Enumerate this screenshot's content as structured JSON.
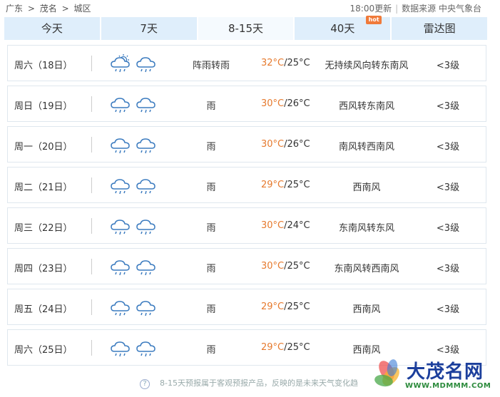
{
  "breadcrumb": {
    "province": "广东",
    "city": "茂名",
    "district": "城区",
    "sep": ">"
  },
  "source": {
    "update_time": "18:00更新",
    "label": "数据来源 中央气象台"
  },
  "tabs": [
    {
      "label": "今天"
    },
    {
      "label": "7天"
    },
    {
      "label": "8-15天",
      "active": true
    },
    {
      "label": "40天",
      "badge": "hot"
    },
    {
      "label": "雷达图"
    }
  ],
  "colors": {
    "tab_bg": "#dfeefb",
    "temp_high": "#e67a2e",
    "icon": "#3b7bbf"
  },
  "forecast": [
    {
      "day": "周六（18日）",
      "icons": [
        "partly-sunny-rain-icon",
        "cloud-rain-icon"
      ],
      "desc": "阵雨转雨",
      "high": "32°C",
      "low": "/25°C",
      "wind": "无持续风向转东南风",
      "level": "<3级"
    },
    {
      "day": "周日（19日）",
      "icons": [
        "cloud-rain-icon",
        "cloud-rain-icon"
      ],
      "desc": "雨",
      "high": "30°C",
      "low": "/26°C",
      "wind": "西风转东南风",
      "level": "<3级"
    },
    {
      "day": "周一（20日）",
      "icons": [
        "cloud-rain-icon",
        "cloud-rain-icon"
      ],
      "desc": "雨",
      "high": "30°C",
      "low": "/26°C",
      "wind": "南风转西南风",
      "level": "<3级"
    },
    {
      "day": "周二（21日）",
      "icons": [
        "cloud-rain-icon",
        "cloud-rain-icon"
      ],
      "desc": "雨",
      "high": "29°C",
      "low": "/25°C",
      "wind": "西南风",
      "level": "<3级"
    },
    {
      "day": "周三（22日）",
      "icons": [
        "cloud-rain-icon",
        "cloud-rain-icon"
      ],
      "desc": "雨",
      "high": "30°C",
      "low": "/24°C",
      "wind": "东南风转东风",
      "level": "<3级"
    },
    {
      "day": "周四（23日）",
      "icons": [
        "cloud-rain-icon",
        "cloud-rain-icon"
      ],
      "desc": "雨",
      "high": "30°C",
      "low": "/25°C",
      "wind": "东南风转西南风",
      "level": "<3级"
    },
    {
      "day": "周五（24日）",
      "icons": [
        "cloud-rain-icon",
        "cloud-rain-icon"
      ],
      "desc": "雨",
      "high": "29°C",
      "low": "/25°C",
      "wind": "西南风",
      "level": "<3级"
    },
    {
      "day": "周六（25日）",
      "icons": [
        "cloud-rain-icon",
        "cloud-rain-icon"
      ],
      "desc": "雨",
      "high": "29°C",
      "low": "/25°C",
      "wind": "西南风",
      "level": "<3级"
    }
  ],
  "footer_note": "8-15天预报属于客观预报产品，反映的是未来天气变化趋",
  "watermark": {
    "title": "大茂名网",
    "url": "WWW.MDMMM.COM"
  }
}
